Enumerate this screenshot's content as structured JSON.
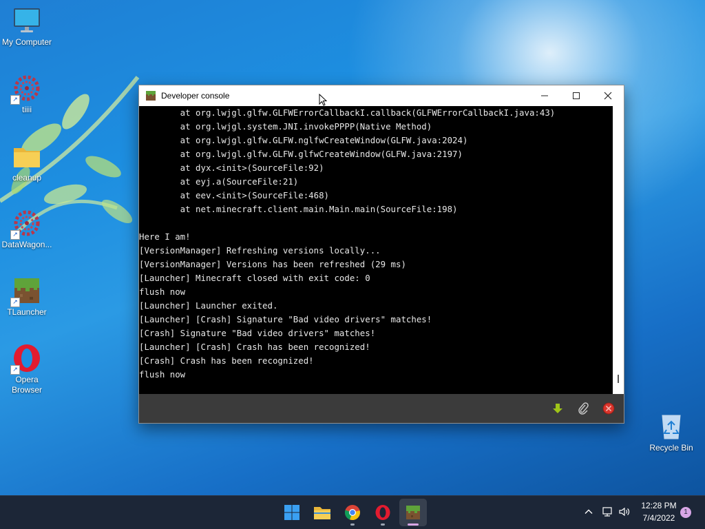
{
  "desktop": {
    "icons": [
      {
        "label": "My Computer"
      },
      {
        "label": "tiiii"
      },
      {
        "label": "cleanup"
      },
      {
        "label": "DataWagon..."
      },
      {
        "label": "TLauncher"
      },
      {
        "label": "Opera Browser"
      },
      {
        "label": "Recycle Bin"
      }
    ]
  },
  "window": {
    "title": "Developer console",
    "icon": "minecraft-grass-block-icon",
    "controls": [
      "minimize-icon",
      "maximize-icon",
      "close-icon"
    ]
  },
  "console": {
    "lines": [
      "        at org.lwjgl.glfw.GLFWErrorCallbackI.callback(GLFWErrorCallbackI.java:43)",
      "        at org.lwjgl.system.JNI.invokePPPP(Native Method)",
      "        at org.lwjgl.glfw.GLFW.nglfwCreateWindow(GLFW.java:2024)",
      "        at org.lwjgl.glfw.GLFW.glfwCreateWindow(GLFW.java:2197)",
      "        at dyx.<init>(SourceFile:92)",
      "        at eyj.a(SourceFile:21)",
      "        at eev.<init>(SourceFile:468)",
      "        at net.minecraft.client.main.Main.main(SourceFile:198)",
      "",
      "Here I am!",
      "[VersionManager] Refreshing versions locally...",
      "[VersionManager] Versions has been refreshed (29 ms)",
      "[Launcher] Minecraft closed with exit code: 0",
      "flush now",
      "[Launcher] Launcher exited.",
      "[Launcher] [Crash] Signature \"Bad video drivers\" matches!",
      "[Crash] Signature \"Bad video drivers\" matches!",
      "[Launcher] [Crash] Crash has been recognized!",
      "[Crash] Crash has been recognized!",
      "flush now"
    ],
    "footer_buttons": [
      "download-arrow-icon",
      "paperclip-icon",
      "close-circle-icon"
    ]
  },
  "taskbar": {
    "apps": [
      "windows-start-icon",
      "file-explorer-icon",
      "chrome-icon",
      "opera-icon",
      "minecraft-icon"
    ],
    "tray": [
      "chevron-up-icon",
      "network-icon",
      "volume-icon"
    ],
    "time": "12:28 PM",
    "date": "7/4/2022",
    "notifications": "1"
  },
  "colors": {
    "console_bg": "#000000",
    "console_text": "#e8e8e8",
    "footer_bg": "#3b3b3b",
    "taskbar_bg": "#1c2637",
    "accent_green": "#9fc419",
    "accent_red": "#d9342b"
  }
}
